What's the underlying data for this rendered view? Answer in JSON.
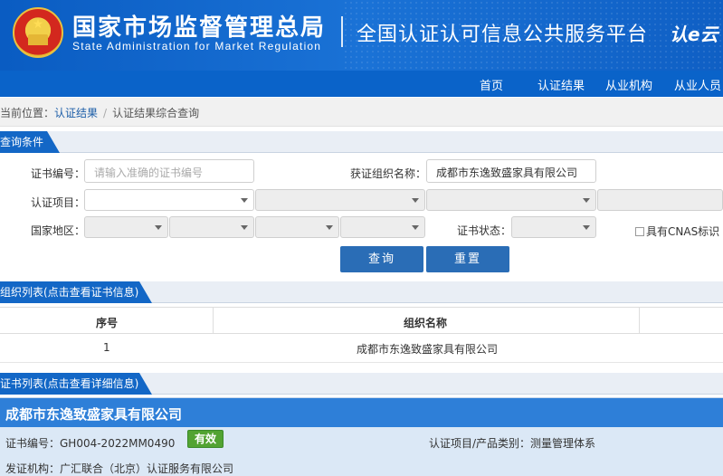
{
  "header": {
    "title_cn": "国家市场监督管理总局",
    "title_en": "State Administration for Market Regulation",
    "platform": "全国认证认可信息公共服务平台",
    "logo_text": "认e云"
  },
  "nav": {
    "items": [
      "首页",
      "认证结果",
      "从业机构",
      "从业人员"
    ]
  },
  "breadcrumb": {
    "prefix": "当前位置：",
    "link": "认证结果",
    "sep": "/",
    "current": "认证结果综合查询"
  },
  "query": {
    "section_title": "查询条件",
    "cert_no_label": "证书编号：",
    "cert_no_placeholder": "请输入准确的证书编号",
    "org_label": "获证组织名称：",
    "org_value": "成都市东逸致盛家具有限公司",
    "project_label": "认证项目：",
    "region_label": "国家地区：",
    "status_label": "证书状态：",
    "cnas_label": "具有CNAS标识",
    "search_button": "查询",
    "reset_button": "重置"
  },
  "org_list": {
    "section_title": "组织列表(点击查看证书信息)",
    "columns": [
      "序号",
      "组织名称"
    ],
    "rows": [
      {
        "index": "1",
        "name": "成都市东逸致盛家具有限公司"
      }
    ]
  },
  "cert_list": {
    "section_title": "证书列表(点击查看详细信息)",
    "card": {
      "org_name": "成都市东逸致盛家具有限公司",
      "cert_no": "证书编号：GH004-2022MM0490",
      "status": "有效",
      "category": "认证项目/产品类别：测量管理体系",
      "issuer": "发证机构：广汇联合（北京）认证服务有限公司"
    }
  },
  "colors": {
    "header_blue": "#0a5cc2",
    "nav_blue": "#0a63c9",
    "valid_green": "#52a332"
  }
}
